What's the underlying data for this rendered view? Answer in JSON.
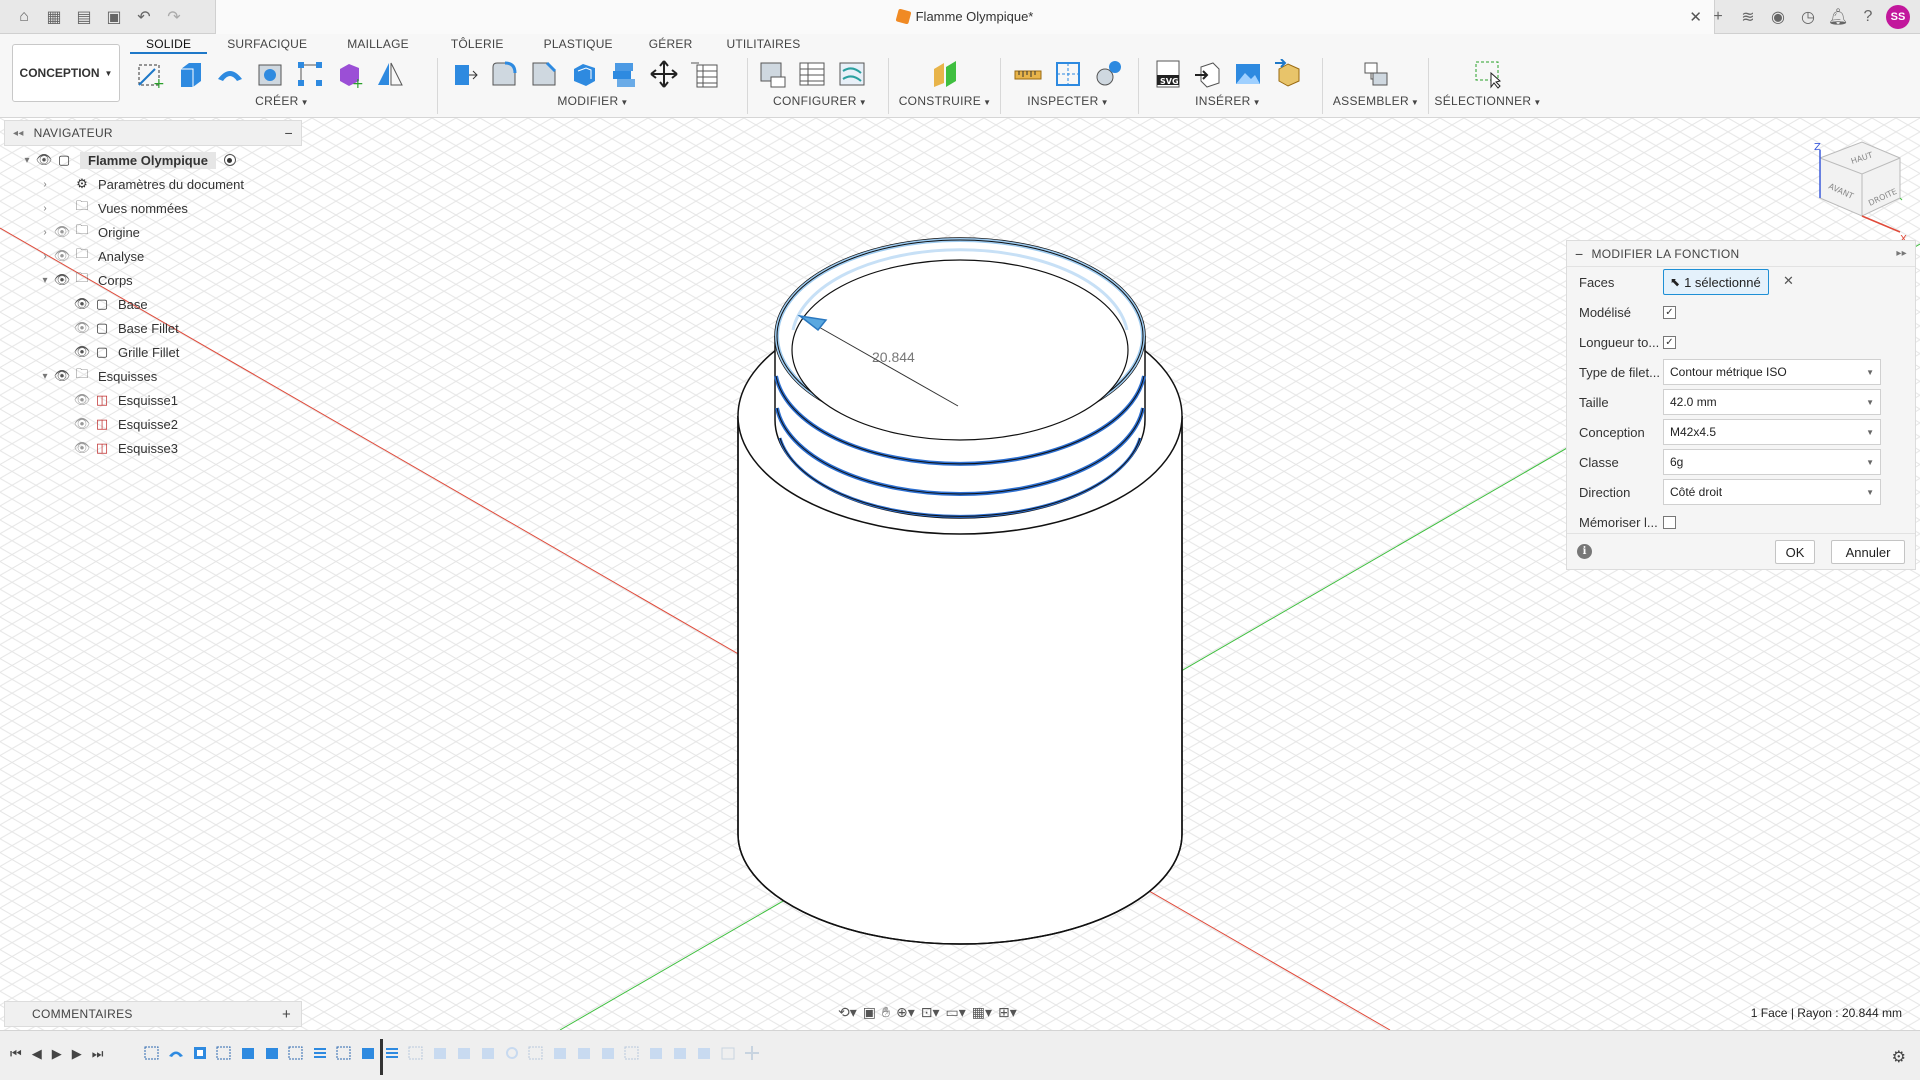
{
  "window": {
    "doc_title": "Flamme Olympique*"
  },
  "ribbon": {
    "workspace": "CONCEPTION",
    "tabs": [
      "SOLIDE",
      "SURFACIQUE",
      "MAILLAGE",
      "TÔLERIE",
      "PLASTIQUE",
      "GÉRER",
      "UTILITAIRES"
    ],
    "groups": {
      "creer": "CRÉER",
      "modifier": "MODIFIER",
      "configurer": "CONFIGURER",
      "construire": "CONSTRUIRE",
      "inspecter": "INSPECTER",
      "inserer": "INSÉRER",
      "assembler": "ASSEMBLER",
      "selectionner": "SÉLECTIONNER"
    }
  },
  "navigator": {
    "title": "NAVIGATEUR",
    "root": "Flamme Olympique",
    "items": {
      "params": "Paramètres du document",
      "views": "Vues nommées",
      "origin": "Origine",
      "analysis": "Analyse",
      "bodies": "Corps",
      "base": "Base",
      "base_fillet": "Base Fillet",
      "grille_fillet": "Grille Fillet",
      "sketches": "Esquisses",
      "sketch1": "Esquisse1",
      "sketch2": "Esquisse2",
      "sketch3": "Esquisse3"
    }
  },
  "viewport": {
    "dimension": "20.844",
    "viewcube": {
      "top": "HAUT",
      "front": "AVANT",
      "right": "DROITE",
      "z": "Z",
      "x": "X"
    }
  },
  "panel": {
    "title": "MODIFIER LA FONCTION",
    "faces_label": "Faces",
    "faces_value": "1 sélectionné",
    "modeled_label": "Modélisé",
    "modeled": true,
    "full_length_label": "Longueur to...",
    "full_length": true,
    "thread_type_label": "Type de filet...",
    "thread_type": "Contour métrique ISO",
    "size_label": "Taille",
    "size": "42.0 mm",
    "designation_label": "Conception",
    "designation": "M42x4.5",
    "class_label": "Classe",
    "class": "6g",
    "direction_label": "Direction",
    "direction": "Côté droit",
    "remember_label": "Mémoriser l...",
    "remember": false,
    "ok": "OK",
    "cancel": "Annuler"
  },
  "comments": {
    "title": "COMMENTAIRES"
  },
  "status": "1 Face | Rayon : 20.844 mm",
  "colors": {
    "accent": "#1e78c8",
    "selection": "#2d7fd0",
    "avatar": "#c2179c",
    "x_axis": "#e04a3a",
    "y_axis": "#3fbf3f"
  },
  "user": {
    "initials": "SS"
  }
}
